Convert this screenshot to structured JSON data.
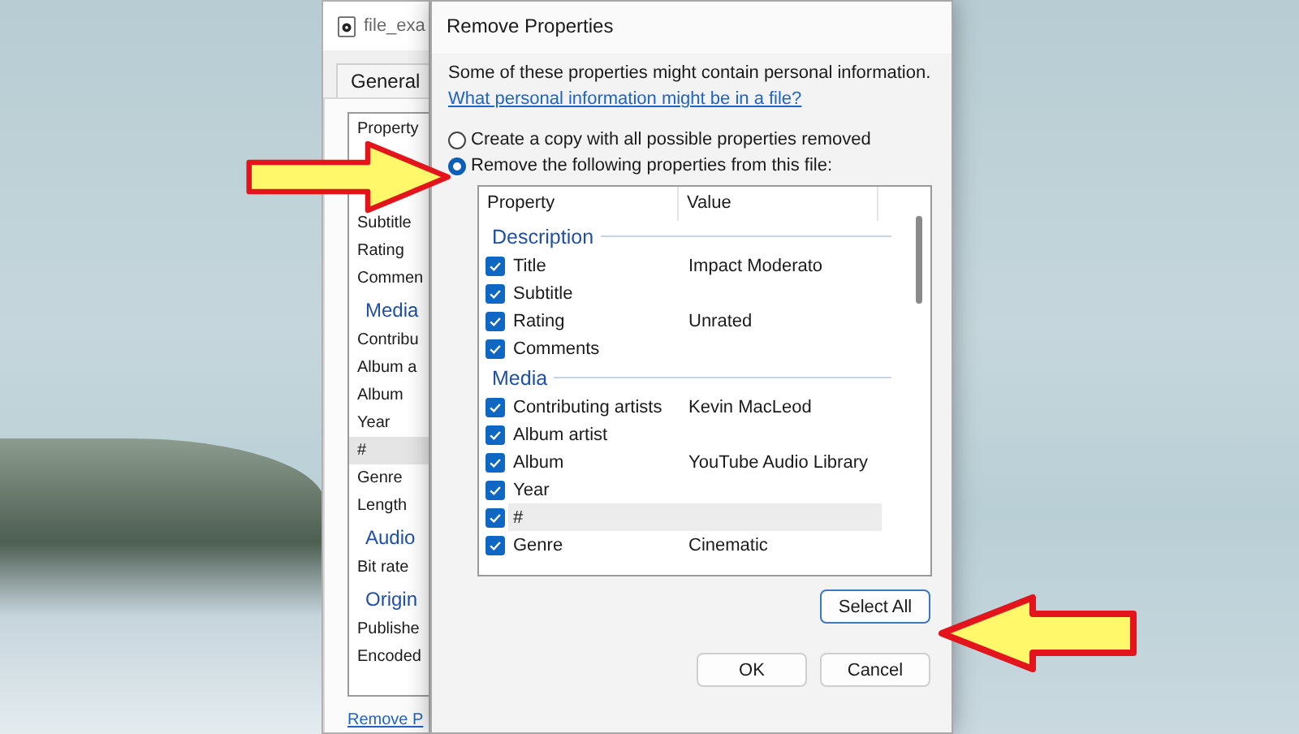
{
  "back_window": {
    "title": "file_exa",
    "tab": "General",
    "list_header": "Property",
    "rows": [
      {
        "kind": "item",
        "label": "Subtitle",
        "selected": false
      },
      {
        "kind": "item",
        "label": "Rating",
        "selected": false
      },
      {
        "kind": "item",
        "label": "Commen",
        "selected": false
      },
      {
        "kind": "group",
        "label": "Media"
      },
      {
        "kind": "item",
        "label": "Contribu",
        "selected": false
      },
      {
        "kind": "item",
        "label": "Album a",
        "selected": false
      },
      {
        "kind": "item",
        "label": "Album",
        "selected": false
      },
      {
        "kind": "item",
        "label": "Year",
        "selected": false
      },
      {
        "kind": "item",
        "label": "#",
        "selected": true
      },
      {
        "kind": "item",
        "label": "Genre",
        "selected": false
      },
      {
        "kind": "item",
        "label": "Length",
        "selected": false
      },
      {
        "kind": "group",
        "label": "Audio"
      },
      {
        "kind": "item",
        "label": "Bit rate",
        "selected": false
      },
      {
        "kind": "group",
        "label": "Origin"
      },
      {
        "kind": "item",
        "label": "Publishe",
        "selected": false
      },
      {
        "kind": "item",
        "label": "Encoded",
        "selected": false
      }
    ],
    "link": "Remove P"
  },
  "dialog": {
    "title": "Remove Properties",
    "message": "Some of these properties might contain personal information.",
    "link": "What personal information might be in a file?",
    "options": [
      {
        "label": "Create a copy with all possible properties removed",
        "selected": false
      },
      {
        "label": "Remove the following properties from this file:",
        "selected": true
      }
    ],
    "table": {
      "columns": [
        "Property",
        "Value"
      ],
      "rows": [
        {
          "kind": "group",
          "label": "Description"
        },
        {
          "kind": "item",
          "property": "Title",
          "value": "Impact Moderato",
          "checked": true,
          "selected": false
        },
        {
          "kind": "item",
          "property": "Subtitle",
          "checked": true,
          "selected": false
        },
        {
          "kind": "item",
          "property": "Rating",
          "value": "Unrated",
          "checked": true,
          "selected": false
        },
        {
          "kind": "item",
          "property": "Comments",
          "checked": true,
          "selected": false
        },
        {
          "kind": "group",
          "label": "Media"
        },
        {
          "kind": "item",
          "property": "Contributing artists",
          "value": "Kevin MacLeod",
          "checked": true,
          "selected": false
        },
        {
          "kind": "item",
          "property": "Album artist",
          "checked": true,
          "selected": false
        },
        {
          "kind": "item",
          "property": "Album",
          "value": "YouTube Audio Library",
          "checked": true,
          "selected": false
        },
        {
          "kind": "item",
          "property": "Year",
          "checked": true,
          "selected": false
        },
        {
          "kind": "item",
          "property": "#",
          "checked": true,
          "selected": true
        },
        {
          "kind": "item",
          "property": "Genre",
          "value": "Cinematic",
          "checked": true,
          "selected": false
        }
      ]
    },
    "select_all": "Select All",
    "buttons": [
      "OK",
      "Cancel"
    ]
  }
}
